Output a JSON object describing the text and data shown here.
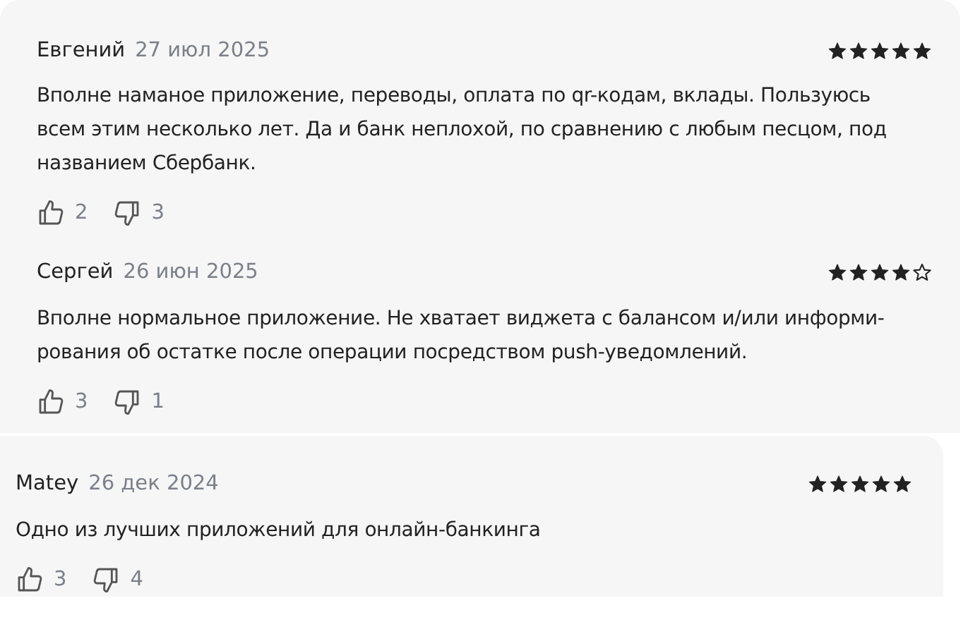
{
  "reviews": [
    {
      "author": "Евгений",
      "date": "27 июл 2025",
      "stars": 5,
      "text": "Вполне наманое приложение, переводы, оплата по qr-кодам, вклады. Пользуюсь всем этим несколько лет. Да и банк неплохой, по сравнению с любым песцом, под названием Сбербанк.",
      "likes": "2",
      "dislikes": "3"
    },
    {
      "author": "Сергей",
      "date": "26 июн 2025",
      "stars": 4,
      "text": "Вполне нормальное приложение. Не хватает виджета с балансом и/или информи-рования об остатке после операции посредством push-уведомлений.",
      "likes": "3",
      "dislikes": "1"
    },
    {
      "author": "Matey",
      "date": "26 дек 2024",
      "stars": 5,
      "text": "Одно из лучших приложений для онлайн-банкинга",
      "likes": "3",
      "dislikes": "4"
    }
  ]
}
